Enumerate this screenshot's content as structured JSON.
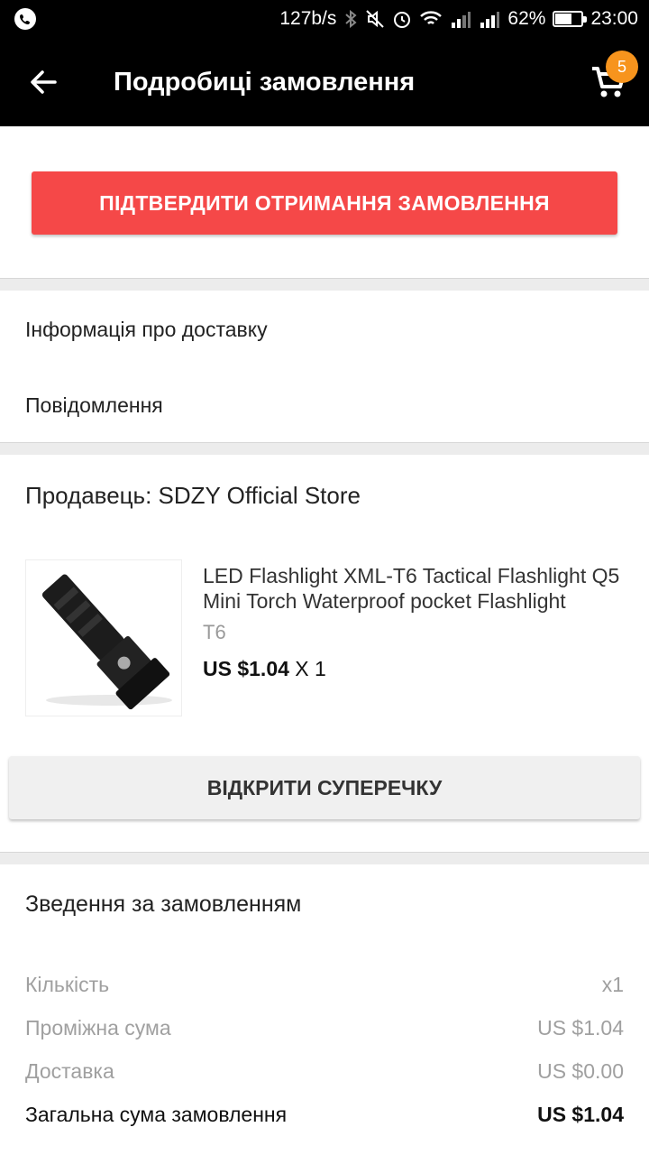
{
  "status_bar": {
    "network_speed": "127b/s",
    "battery_percent": "62%",
    "battery_level": 0.62,
    "time": "23:00"
  },
  "app_bar": {
    "title": "Подробиці замовлення",
    "cart_count": "5"
  },
  "actions": {
    "confirm_label": "ПІДТВЕРДИТИ ОТРИМАННЯ ЗАМОВЛЕННЯ",
    "dispute_label": "ВІДКРИТИ СУПЕРЕЧКУ"
  },
  "links": {
    "delivery_info": "Інформація про доставку",
    "messages": "Повідомлення"
  },
  "seller": {
    "label": "Продавець: SDZY Official Store"
  },
  "product": {
    "title": "LED Flashlight XML-T6 Tactical Flashlight Q5 Mini Torch Waterproof  pocket Flashlight",
    "variant": "T6",
    "price": "US $1.04",
    "quantity": "X 1"
  },
  "summary": {
    "title": "Зведення за замовленням",
    "rows": [
      {
        "label": "Кількість",
        "value": "x1"
      },
      {
        "label": "Проміжна сума",
        "value": "US $1.04"
      },
      {
        "label": "Доставка",
        "value": "US $0.00"
      },
      {
        "label": "Загальна сума замовлення",
        "value": "US $1.04"
      }
    ]
  },
  "colors": {
    "confirm_button": "#f54848",
    "cart_badge": "#f7941d",
    "app_bar": "#000000"
  },
  "icons": [
    "viber-icon",
    "bluetooth-icon",
    "mute-icon",
    "alarm-icon",
    "wifi-icon",
    "signal-icon",
    "battery-icon",
    "back-arrow-icon",
    "cart-icon"
  ]
}
